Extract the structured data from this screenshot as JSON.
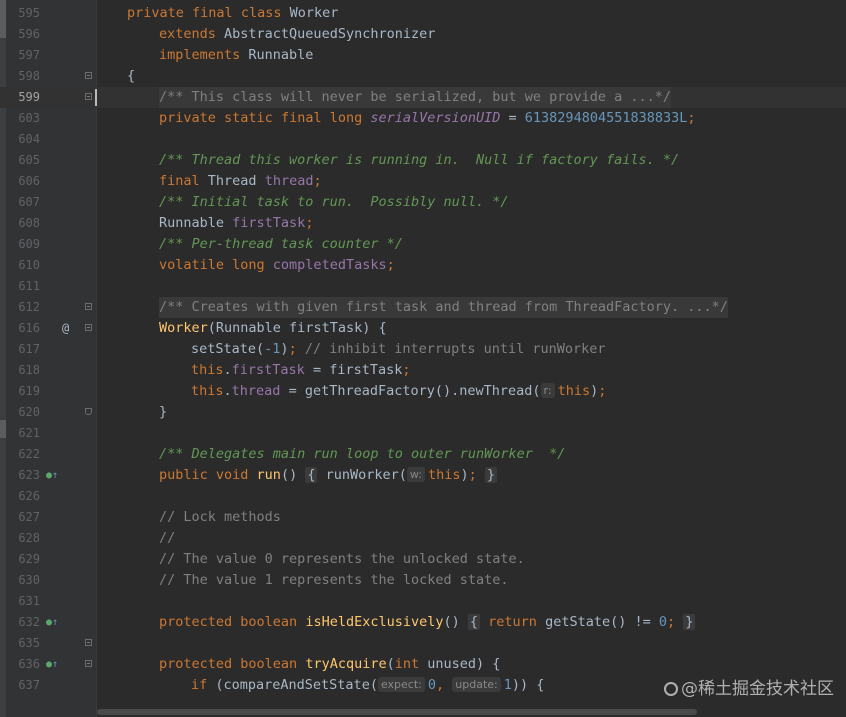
{
  "lines": [
    {
      "n": "595",
      "segs": [
        {
          "t": "private ",
          "c": "kw"
        },
        {
          "t": "final ",
          "c": "kw"
        },
        {
          "t": "class ",
          "c": "kw"
        },
        {
          "t": "Worker",
          "c": ""
        }
      ]
    },
    {
      "n": "596",
      "segs": [
        {
          "t": "extends ",
          "c": "kw"
        },
        {
          "t": "AbstractQueuedSynchronizer",
          "c": ""
        }
      ]
    },
    {
      "n": "597",
      "segs": [
        {
          "t": "implements ",
          "c": "kw"
        },
        {
          "t": "Runnable",
          "c": ""
        }
      ]
    },
    {
      "n": "598",
      "segs": [
        {
          "t": "{",
          "c": ""
        }
      ]
    },
    {
      "n": "599",
      "segs": [
        {
          "t": "/** This class will never be serialized, but we provide a ...*/",
          "c": "cmt"
        }
      ]
    },
    {
      "n": "603",
      "segs": [
        {
          "t": "private ",
          "c": "kw"
        },
        {
          "t": "static ",
          "c": "kw"
        },
        {
          "t": "final ",
          "c": "kw"
        },
        {
          "t": "long ",
          "c": "kw"
        },
        {
          "t": "serialVersionUID",
          "c": "sfld"
        },
        {
          "t": " = ",
          "c": ""
        },
        {
          "t": "6138294804551838833L",
          "c": "num"
        },
        {
          "t": ";",
          "c": "kw"
        }
      ]
    },
    {
      "n": "604",
      "segs": []
    },
    {
      "n": "605",
      "segs": [
        {
          "t": "/** Thread this worker is running in.  Null if factory fails. */",
          "c": "doc"
        }
      ]
    },
    {
      "n": "606",
      "segs": [
        {
          "t": "final ",
          "c": "kw"
        },
        {
          "t": "Thread ",
          "c": ""
        },
        {
          "t": "thread",
          "c": "fld"
        },
        {
          "t": ";",
          "c": "kw"
        }
      ]
    },
    {
      "n": "607",
      "segs": [
        {
          "t": "/** Initial task to run.  Possibly null. */",
          "c": "doc"
        }
      ]
    },
    {
      "n": "608",
      "segs": [
        {
          "t": "Runnable ",
          "c": ""
        },
        {
          "t": "firstTask",
          "c": "fld"
        },
        {
          "t": ";",
          "c": "kw"
        }
      ]
    },
    {
      "n": "609",
      "segs": [
        {
          "t": "/** Per-thread task counter */",
          "c": "doc"
        }
      ]
    },
    {
      "n": "610",
      "segs": [
        {
          "t": "volatile ",
          "c": "kw"
        },
        {
          "t": "long ",
          "c": "kw"
        },
        {
          "t": "completedTasks",
          "c": "fld"
        },
        {
          "t": ";",
          "c": "kw"
        }
      ]
    },
    {
      "n": "611",
      "segs": []
    },
    {
      "n": "612",
      "segs": [
        {
          "t": "/** Creates with given first task and thread from ThreadFactory. ...*/",
          "c": "cmt"
        }
      ]
    },
    {
      "n": "616",
      "segs": [
        {
          "t": "Worker",
          "c": "fn"
        },
        {
          "t": "(Runnable firstTask) {",
          "c": ""
        }
      ]
    },
    {
      "n": "617",
      "segs": [
        {
          "t": "setState(",
          "c": ""
        },
        {
          "t": "-1",
          "c": "num"
        },
        {
          "t": ")",
          "c": ""
        },
        {
          "t": "; ",
          "c": "kw"
        },
        {
          "t": "// inhibit interrupts until runWorker",
          "c": "cmt"
        }
      ]
    },
    {
      "n": "618",
      "segs": [
        {
          "t": "this",
          "c": "kw"
        },
        {
          "t": ".",
          "c": ""
        },
        {
          "t": "firstTask",
          "c": "fld"
        },
        {
          "t": " = firstTask",
          "c": ""
        },
        {
          "t": ";",
          "c": "kw"
        }
      ]
    },
    {
      "n": "619",
      "segs": [
        {
          "t": "this",
          "c": "kw"
        },
        {
          "t": ".",
          "c": ""
        },
        {
          "t": "thread",
          "c": "fld"
        },
        {
          "t": " = getThreadFactory().newThread(",
          "c": ""
        },
        {
          "t": "r:",
          "c": "hint"
        },
        {
          "t": "this",
          "c": "kw"
        },
        {
          "t": ")",
          "c": ""
        },
        {
          "t": ";",
          "c": "kw"
        }
      ]
    },
    {
      "n": "620",
      "segs": [
        {
          "t": "}",
          "c": ""
        }
      ]
    },
    {
      "n": "621",
      "segs": []
    },
    {
      "n": "622",
      "segs": [
        {
          "t": "/** Delegates main run loop to outer runWorker  */",
          "c": "doc"
        }
      ]
    },
    {
      "n": "623",
      "segs": [
        {
          "t": "public ",
          "c": "kw"
        },
        {
          "t": "void ",
          "c": "kw"
        },
        {
          "t": "run",
          "c": "fn"
        },
        {
          "t": "() ",
          "c": ""
        },
        {
          "t": "{",
          "c": "brk"
        },
        {
          "t": " runWorker(",
          "c": ""
        },
        {
          "t": "w:",
          "c": "hint"
        },
        {
          "t": "this",
          "c": "kw"
        },
        {
          "t": ")",
          "c": ""
        },
        {
          "t": ";",
          "c": "kw"
        },
        {
          "t": " ",
          "c": ""
        },
        {
          "t": "}",
          "c": "brk"
        }
      ]
    },
    {
      "n": "626",
      "segs": []
    },
    {
      "n": "627",
      "segs": [
        {
          "t": "// Lock methods",
          "c": "cmt"
        }
      ]
    },
    {
      "n": "628",
      "segs": [
        {
          "t": "//",
          "c": "cmt"
        }
      ]
    },
    {
      "n": "629",
      "segs": [
        {
          "t": "// The value 0 represents the unlocked state.",
          "c": "cmt"
        }
      ]
    },
    {
      "n": "630",
      "segs": [
        {
          "t": "// The value 1 represents the locked state.",
          "c": "cmt"
        }
      ]
    },
    {
      "n": "631",
      "segs": []
    },
    {
      "n": "632",
      "segs": [
        {
          "t": "protected ",
          "c": "kw"
        },
        {
          "t": "boolean ",
          "c": "kw"
        },
        {
          "t": "isHeldExclusively",
          "c": "fn"
        },
        {
          "t": "() ",
          "c": ""
        },
        {
          "t": "{",
          "c": "brk"
        },
        {
          "t": " ",
          "c": ""
        },
        {
          "t": "return ",
          "c": "kw"
        },
        {
          "t": "getState() != ",
          "c": ""
        },
        {
          "t": "0",
          "c": "num"
        },
        {
          "t": ";",
          "c": "kw"
        },
        {
          "t": " ",
          "c": ""
        },
        {
          "t": "}",
          "c": "brk"
        }
      ]
    },
    {
      "n": "635",
      "segs": []
    },
    {
      "n": "636",
      "segs": [
        {
          "t": "protected ",
          "c": "kw"
        },
        {
          "t": "boolean ",
          "c": "kw"
        },
        {
          "t": "tryAcquire",
          "c": "fn"
        },
        {
          "t": "(",
          "c": ""
        },
        {
          "t": "int ",
          "c": "kw"
        },
        {
          "t": "unused) {",
          "c": ""
        }
      ]
    },
    {
      "n": "637",
      "segs": [
        {
          "t": "if ",
          "c": "kw"
        },
        {
          "t": "(compareAndSetState(",
          "c": ""
        },
        {
          "t": "expect:",
          "c": "hint"
        },
        {
          "t": "0",
          "c": "num"
        },
        {
          "t": ", ",
          "c": "kw"
        },
        {
          "t": "update:",
          "c": "hint"
        },
        {
          "t": "1",
          "c": "num"
        },
        {
          "t": ")) {",
          "c": ""
        }
      ]
    }
  ],
  "watermark": "@稀土掘金技术社区"
}
